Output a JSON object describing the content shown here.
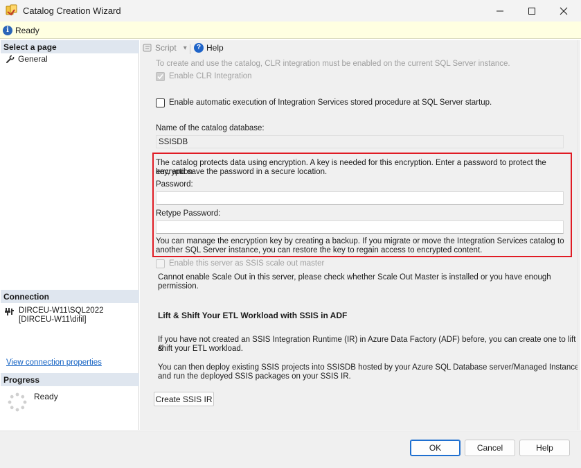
{
  "window": {
    "title": "Catalog Creation Wizard",
    "minimize_glyph": "—",
    "maximize_glyph": "□",
    "close_glyph": "✕"
  },
  "status": {
    "text": "Ready",
    "icon": "info-icon"
  },
  "left": {
    "select_page_header": "Select a page",
    "pages": [
      {
        "label": "General",
        "icon": "wrench-icon"
      }
    ],
    "connection_header": "Connection",
    "connection_server": "DIRCEU-W11\\SQL2022",
    "connection_user": "[DIRCEU-W11\\difil]",
    "connection_link": "View connection properties",
    "progress_header": "Progress",
    "progress_status": "Ready"
  },
  "toolbar": {
    "script_label": "Script",
    "script_arrow": "▾",
    "help_label": "Help",
    "help_glyph": "?"
  },
  "form": {
    "clr_note": "To create and use the catalog, CLR integration must be enabled on the current SQL Server instance.",
    "enable_clr_label": "Enable CLR Integration",
    "enable_clr_checked": true,
    "auto_exec_label": "Enable automatic execution of Integration Services stored procedure at SQL Server startup.",
    "auto_exec_checked": false,
    "catalog_db_label": "Name of the catalog database:",
    "catalog_db_value": "SSISDB",
    "encryption_note_line1": "The catalog protects data using encryption. A key is needed for this encryption. Enter a password to protect the encryption",
    "encryption_note_line2": "key, and save the password in a secure location.",
    "password_label": "Password:",
    "password_value": "",
    "retype_password_label": "Retype Password:",
    "retype_password_value": "",
    "backup_note_line1": "You can manage the encryption key by creating a backup. If you migrate or move the Integration Services catalog to",
    "backup_note_line2": "another SQL Server instance, you can restore the key to regain access to encrypted content.",
    "scale_out_label": "Enable this server as SSIS scale out master",
    "scale_out_checked": false,
    "scale_out_note": "Cannot enable Scale Out in this server, please check whether Scale Out Master is installed or you have enough permission.",
    "lift_shift_title": "Lift & Shift Your ETL Workload with SSIS in ADF",
    "adf_note_line1": "If you have not created an SSIS Integration Runtime (IR) in Azure Data Factory (ADF) before, you can create one to lift &",
    "adf_note_line2": "shift your ETL workload.",
    "deploy_note_line1": "You can then deploy existing SSIS projects into SSISDB hosted by your Azure SQL Database server/Managed Instance",
    "deploy_note_line2": "and run the deployed SSIS packages on your SSIS IR.",
    "create_ssis_ir_button": "Create SSIS IR"
  },
  "footer": {
    "ok_label": "OK",
    "cancel_label": "Cancel",
    "help_label": "Help"
  },
  "colors": {
    "highlight_box": "#e01b24",
    "status_bar_bg": "#ffffe1",
    "section_header_bg": "#dfe6ef",
    "link": "#0f5fc2",
    "primary_border": "#1e6fd0"
  }
}
